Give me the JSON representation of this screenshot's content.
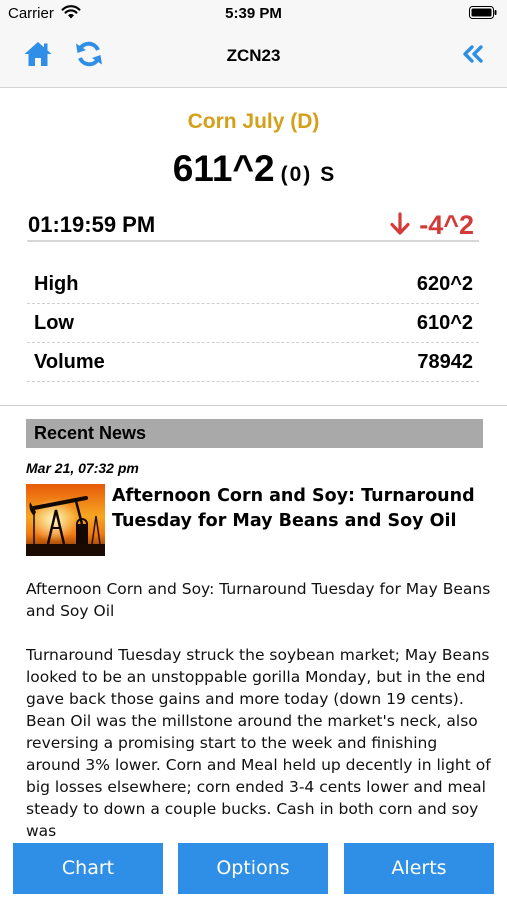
{
  "status_bar": {
    "carrier": "Carrier",
    "time": "5:39 PM"
  },
  "nav": {
    "title": "ZCN23",
    "accent_color": "#2f8fe6"
  },
  "quote": {
    "contract_name": "Corn July (D)",
    "price": "611^2",
    "change_paren": "(0)",
    "flag": "S",
    "time": "01:19:59 PM",
    "net_change": "-4^2",
    "change_direction": "down",
    "change_color": "#d53a3a",
    "name_color": "#d4a01a",
    "stats": [
      {
        "label": "High",
        "value": "620^2"
      },
      {
        "label": "Low",
        "value": "610^2"
      },
      {
        "label": "Volume",
        "value": "78942"
      }
    ]
  },
  "news": {
    "section_title": "Recent News",
    "date": "Mar 21, 07:32 pm",
    "headline": "Afternoon Corn and Soy: Turnaround Tuesday for May Beans and Soy Oil",
    "summary": "Afternoon Corn and Soy: Turnaround Tuesday for May Beans and Soy Oil",
    "body": "Turnaround Tuesday struck the soybean market; May Beans looked to be an unstoppable gorilla Monday, but in the end gave back those gains and more today (down 19 cents). Bean Oil was the millstone around the market's neck, also reversing a promising start to the week and finishing around 3% lower. Corn and Meal held up decently in light of big losses elsewhere; corn ended 3-4 cents lower and meal steady to down a couple bucks. Cash in both corn and soy was"
  },
  "tabs": [
    {
      "label": "Chart"
    },
    {
      "label": "Options"
    },
    {
      "label": "Alerts"
    }
  ]
}
